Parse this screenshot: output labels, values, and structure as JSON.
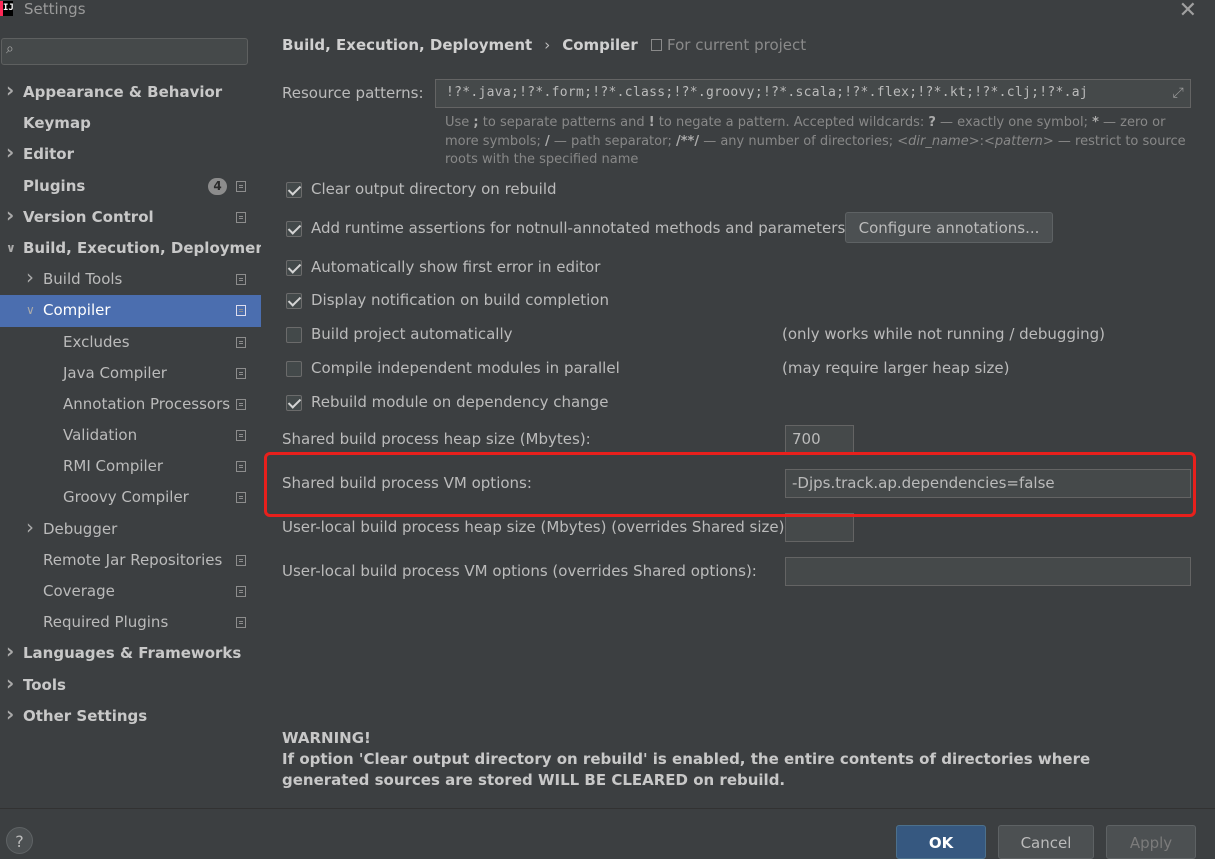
{
  "window": {
    "title": "Settings",
    "app_icon_text": "IJ",
    "close_icon": "✕"
  },
  "search": {
    "placeholder": "",
    "value": ""
  },
  "sidebar": {
    "items": [
      {
        "label": "Appearance & Behavior",
        "level": 0,
        "expandable": true,
        "expanded": false,
        "bold": true
      },
      {
        "label": "Keymap",
        "level": 0,
        "expandable": false,
        "bold": true
      },
      {
        "label": "Editor",
        "level": 0,
        "expandable": true,
        "expanded": false,
        "bold": true
      },
      {
        "label": "Plugins",
        "level": 0,
        "expandable": false,
        "bold": true,
        "badge": "4",
        "project_icon": true
      },
      {
        "label": "Version Control",
        "level": 0,
        "expandable": true,
        "expanded": false,
        "bold": true,
        "project_icon": true
      },
      {
        "label": "Build, Execution, Deployment",
        "level": 0,
        "expandable": true,
        "expanded": true,
        "bold": true
      },
      {
        "label": "Build Tools",
        "level": 1,
        "expandable": true,
        "expanded": false,
        "project_icon": true
      },
      {
        "label": "Compiler",
        "level": 1,
        "expandable": true,
        "expanded": true,
        "selected": true,
        "project_icon": true
      },
      {
        "label": "Excludes",
        "level": 2,
        "project_icon": true
      },
      {
        "label": "Java Compiler",
        "level": 2,
        "project_icon": true
      },
      {
        "label": "Annotation Processors",
        "level": 2,
        "project_icon": true
      },
      {
        "label": "Validation",
        "level": 2,
        "project_icon": true
      },
      {
        "label": "RMI Compiler",
        "level": 2,
        "project_icon": true
      },
      {
        "label": "Groovy Compiler",
        "level": 2,
        "project_icon": true
      },
      {
        "label": "Debugger",
        "level": 1,
        "expandable": true,
        "expanded": false
      },
      {
        "label": "Remote Jar Repositories",
        "level": 1,
        "project_icon": true
      },
      {
        "label": "Coverage",
        "level": 1,
        "project_icon": true
      },
      {
        "label": "Required Plugins",
        "level": 1,
        "project_icon": true
      },
      {
        "label": "Languages & Frameworks",
        "level": 0,
        "expandable": true,
        "expanded": false,
        "bold": true
      },
      {
        "label": "Tools",
        "level": 0,
        "expandable": true,
        "expanded": false,
        "bold": true
      },
      {
        "label": "Other Settings",
        "level": 0,
        "expandable": true,
        "expanded": false,
        "bold": true
      }
    ]
  },
  "breadcrumb": {
    "parent": "Build, Execution, Deployment",
    "separator": "›",
    "current": "Compiler"
  },
  "scope": {
    "label": "For current project"
  },
  "resource_patterns": {
    "label": "Resource patterns:",
    "value": "!?*.java;!?*.form;!?*.class;!?*.groovy;!?*.scala;!?*.flex;!?*.kt;!?*.clj;!?*.aj",
    "expand_icon": "⤢"
  },
  "hint": {
    "p1": "Use ",
    "sep1": ";",
    "p2": " to separate patterns and ",
    "neg": "!",
    "p3": " to negate a pattern. Accepted wildcards: ",
    "w1": "?",
    "p4": " — exactly one symbol; ",
    "w2": "*",
    "p5": " — zero or more symbols; ",
    "w3": "/",
    "p6": " — path separator; ",
    "w4": "/**/",
    "p7": " — any number of directories; ",
    "dir": "<dir_name>",
    "colon": ":",
    "pat": "<pattern>",
    "p8": " — restrict to source roots with the specified name"
  },
  "options": [
    {
      "label": "Clear output directory on rebuild",
      "checked": true
    },
    {
      "label": "Add runtime assertions for notnull-annotated methods and parameters",
      "checked": true
    },
    {
      "label": "Automatically show first error in editor",
      "checked": true
    },
    {
      "label": "Display notification on build completion",
      "checked": true
    },
    {
      "label": "Build project automatically",
      "checked": false,
      "note": "(only works while not running / debugging)"
    },
    {
      "label": "Compile independent modules in parallel",
      "checked": false,
      "note": "(may require larger heap size)"
    },
    {
      "label": "Rebuild module on dependency change",
      "checked": true
    }
  ],
  "configure_annotations_button": "Configure annotations...",
  "fields": {
    "shared_heap": {
      "label": "Shared build process heap size (Mbytes):",
      "value": "700"
    },
    "shared_vm": {
      "label": "Shared build process VM options:",
      "value": "-Djps.track.ap.dependencies=false"
    },
    "user_heap": {
      "label": "User-local build process heap size (Mbytes) (overrides Shared size):",
      "value": ""
    },
    "user_vm": {
      "label": "User-local build process VM options (overrides Shared options):",
      "value": ""
    }
  },
  "warning": {
    "title": "WARNING!",
    "text": "If option 'Clear output directory on rebuild' is enabled, the entire contents of directories where generated sources are stored WILL BE CLEARED on rebuild."
  },
  "buttons": {
    "help": "?",
    "ok": "OK",
    "cancel": "Cancel",
    "apply": "Apply"
  },
  "colors": {
    "background": "#3c3f41",
    "selection": "#4b6eaf",
    "highlight_border": "#e8201c",
    "ok_button": "#365880"
  }
}
